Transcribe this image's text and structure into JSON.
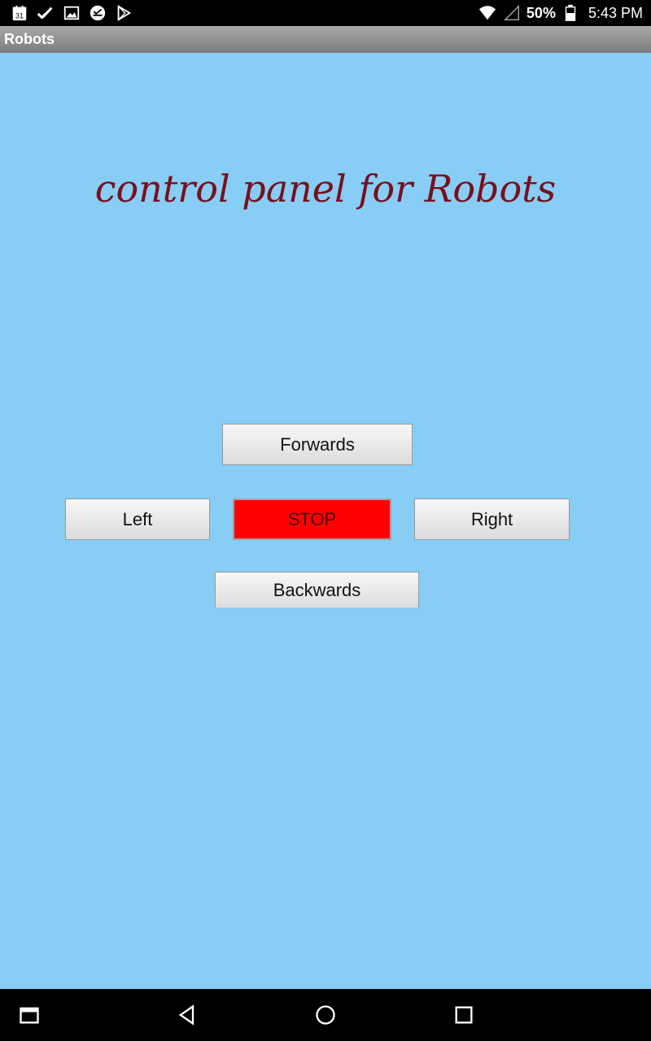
{
  "status_bar": {
    "icons": [
      "calendar-icon",
      "check-icon",
      "image-icon",
      "inbox-icon",
      "play-store-icon"
    ],
    "calendar_day": "31",
    "battery_percent": "50%",
    "time": "5:43 PM"
  },
  "app": {
    "title": "Robots"
  },
  "main": {
    "heading": "control panel for Robots",
    "buttons": {
      "forwards": "Forwards",
      "left": "Left",
      "stop": "STOP",
      "right": "Right",
      "backwards": "Backwards"
    }
  },
  "colors": {
    "background": "#87cdf5",
    "heading": "#7a0f1c",
    "stop_button": "#ff0000"
  },
  "nav_bar": {
    "icons": [
      "recent-apps-icon",
      "back-icon",
      "home-icon",
      "overview-icon"
    ]
  }
}
